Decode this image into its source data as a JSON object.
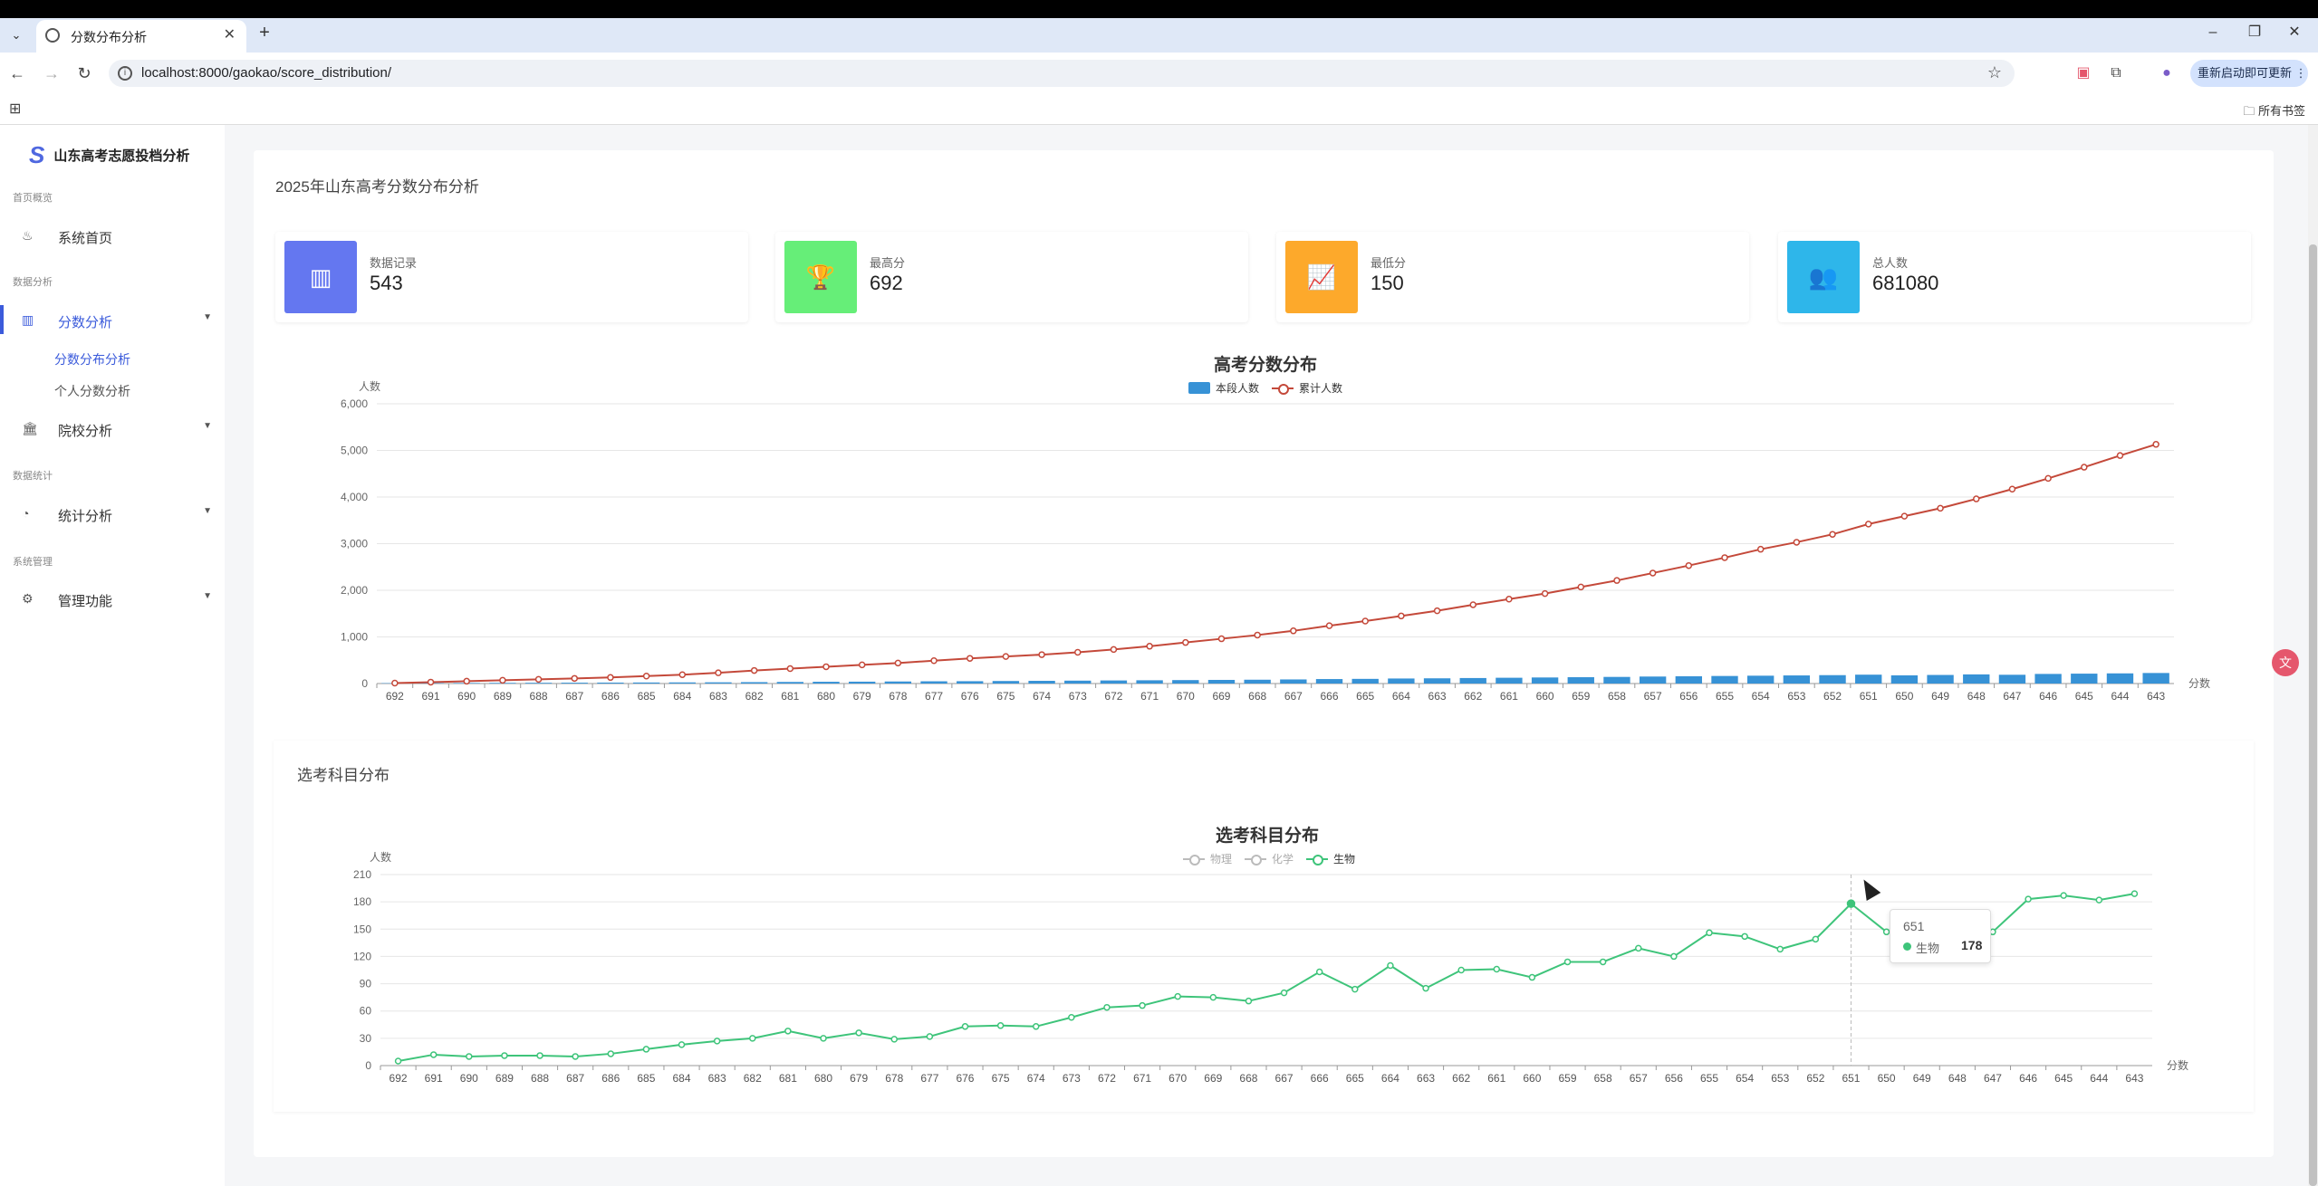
{
  "browser": {
    "tab_title": "分数分布分析",
    "url": "localhost:8000/gaokao/score_distribution/",
    "update_label": "重新启动即可更新",
    "bookmarks_label": "所有书签"
  },
  "sidebar": {
    "brand": "山东高考志愿投档分析",
    "sections": [
      "首页概览",
      "数据分析",
      "数据统计",
      "系统管理"
    ],
    "items": [
      {
        "label": "系统首页",
        "icon": "fire-icon"
      },
      {
        "label": "分数分析",
        "icon": "bar-chart-icon"
      },
      {
        "label": "院校分析",
        "icon": "bank-icon"
      },
      {
        "label": "统计分析",
        "icon": "pie-chart-icon"
      },
      {
        "label": "管理功能",
        "icon": "gears-icon"
      }
    ],
    "subitems": [
      "分数分布分析",
      "个人分数分析"
    ]
  },
  "page": {
    "title": "2025年山东高考分数分布分析",
    "subject_section_title": "选考科目分布"
  },
  "cards": [
    {
      "label": "数据记录",
      "value": "543",
      "color": "#6477f0",
      "icon": "bar-chart-icon"
    },
    {
      "label": "最高分",
      "value": "692",
      "color": "#66ee78",
      "icon": "trophy-icon"
    },
    {
      "label": "最低分",
      "value": "150",
      "color": "#fda92b",
      "icon": "area-chart-icon"
    },
    {
      "label": "总人数",
      "value": "681080",
      "color": "#2eb6ea",
      "icon": "users-icon"
    }
  ],
  "tooltip": {
    "title": "651",
    "series": "生物",
    "value": "178"
  },
  "chart_data": [
    {
      "type": "bar",
      "title": "高考分数分布",
      "ylabel": "人数",
      "xlabel": "分数",
      "ylim": [
        0,
        6000
      ],
      "yticks": [
        0,
        1000,
        2000,
        3000,
        4000,
        5000,
        6000
      ],
      "ytick_labels": [
        "0",
        "1,000",
        "2,000",
        "3,000",
        "4,000",
        "5,000",
        "6,000"
      ],
      "legend_position": "top-center",
      "categories": [
        "692",
        "691",
        "690",
        "689",
        "688",
        "687",
        "686",
        "685",
        "684",
        "683",
        "682",
        "681",
        "680",
        "679",
        "678",
        "677",
        "676",
        "675",
        "674",
        "673",
        "672",
        "671",
        "670",
        "669",
        "668",
        "667",
        "666",
        "665",
        "664",
        "663",
        "662",
        "661",
        "660",
        "659",
        "658",
        "657",
        "656",
        "655",
        "654",
        "653",
        "652",
        "651",
        "650",
        "649",
        "648",
        "647",
        "646",
        "645",
        "644",
        "643"
      ],
      "series": [
        {
          "name": "本段人数",
          "type": "bar",
          "color": "#3792d6",
          "values": [
            8,
            10,
            12,
            14,
            16,
            18,
            20,
            22,
            24,
            26,
            30,
            34,
            38,
            40,
            44,
            48,
            50,
            54,
            58,
            62,
            66,
            70,
            74,
            78,
            82,
            88,
            96,
            100,
            108,
            112,
            118,
            124,
            130,
            136,
            142,
            150,
            156,
            162,
            168,
            174,
            180,
            190,
            176,
            184,
            196,
            188,
            206,
            212,
            218,
            226
          ]
        },
        {
          "name": "累计人数",
          "type": "line",
          "color": "#c4493a",
          "values": [
            10,
            30,
            50,
            70,
            90,
            110,
            130,
            160,
            190,
            230,
            280,
            320,
            360,
            400,
            440,
            490,
            540,
            580,
            620,
            670,
            730,
            800,
            880,
            960,
            1040,
            1130,
            1240,
            1340,
            1450,
            1560,
            1690,
            1810,
            1930,
            2070,
            2210,
            2370,
            2530,
            2700,
            2880,
            3030,
            3200,
            3420,
            3590,
            3760,
            3960,
            4170,
            4400,
            4640,
            4890,
            5130
          ]
        }
      ]
    },
    {
      "type": "line",
      "title": "选考科目分布",
      "ylabel": "人数",
      "xlabel": "分数",
      "ylim": [
        0,
        210
      ],
      "yticks": [
        0,
        30,
        60,
        90,
        120,
        150,
        180,
        210
      ],
      "legend_position": "top-center",
      "categories": [
        "692",
        "691",
        "690",
        "689",
        "688",
        "687",
        "686",
        "685",
        "684",
        "683",
        "682",
        "681",
        "680",
        "679",
        "678",
        "677",
        "676",
        "675",
        "674",
        "673",
        "672",
        "671",
        "670",
        "669",
        "668",
        "667",
        "666",
        "665",
        "664",
        "663",
        "662",
        "661",
        "660",
        "659",
        "658",
        "657",
        "656",
        "655",
        "654",
        "653",
        "652",
        "651",
        "650",
        "649",
        "648",
        "647",
        "646",
        "645",
        "644",
        "643"
      ],
      "series": [
        {
          "name": "物理",
          "visible": false,
          "color": "#aaaaaa",
          "values": []
        },
        {
          "name": "化学",
          "visible": false,
          "color": "#aaaaaa",
          "values": []
        },
        {
          "name": "生物",
          "visible": true,
          "color": "#3ec47a",
          "values": [
            5,
            12,
            10,
            11,
            11,
            10,
            13,
            18,
            23,
            27,
            30,
            38,
            30,
            36,
            29,
            32,
            43,
            44,
            43,
            53,
            64,
            66,
            76,
            75,
            71,
            80,
            103,
            84,
            110,
            85,
            105,
            106,
            97,
            114,
            114,
            129,
            120,
            146,
            142,
            128,
            139,
            178,
            147,
            150,
            148,
            147,
            183,
            187,
            182,
            189
          ]
        }
      ]
    }
  ]
}
